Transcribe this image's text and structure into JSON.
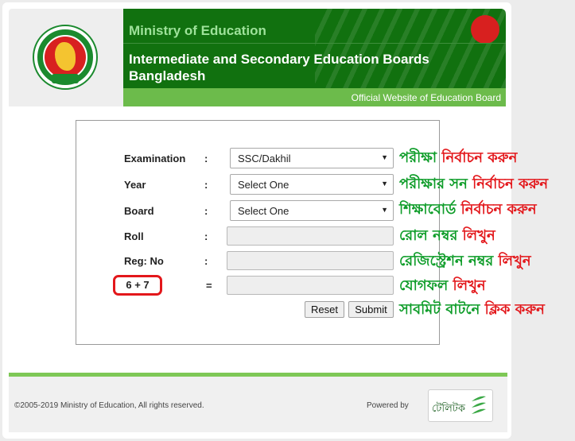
{
  "header": {
    "ministry_title": "Ministry of Education",
    "board_title": "Intermediate and Secondary Education Boards Bangladesh",
    "subtitle": "Official Website of Education Board",
    "seal_icon": "government-seal-icon"
  },
  "form": {
    "examination": {
      "label": "Examination",
      "colon": ":",
      "selected": "SSC/Dakhil"
    },
    "year": {
      "label": "Year",
      "colon": ":",
      "selected": "Select One"
    },
    "board": {
      "label": "Board",
      "colon": ":",
      "selected": "Select One"
    },
    "roll": {
      "label": "Roll",
      "colon": ":",
      "value": ""
    },
    "reg": {
      "label": "Reg: No",
      "colon": ":",
      "value": ""
    },
    "captcha": {
      "question": "6 + 7",
      "equals": "=",
      "value": ""
    },
    "reset_label": "Reset",
    "submit_label": "Submit"
  },
  "hints": {
    "examination": {
      "green": "পরীক্ষা",
      "red": "নির্বাচন করুন"
    },
    "year": {
      "green": "পরীক্ষার সন",
      "red": "নির্বাচন করুন"
    },
    "board": {
      "green": "শিক্ষাবোর্ড",
      "red": "নির্বাচন করুন"
    },
    "roll": {
      "green": "রোল নম্বর",
      "red": "লিখুন"
    },
    "reg": {
      "green": "রেজিস্ট্রেশন নম্বর",
      "red": "লিখুন"
    },
    "captcha": {
      "green": "যোগফল",
      "red": "লিখুন"
    },
    "submit": {
      "green": "সাবমিট বাটনে",
      "red": "ক্লিক করুন"
    }
  },
  "footer": {
    "copyright": "©2005-2019 Ministry of Education, All rights reserved.",
    "powered_by": "Powered by",
    "vendor_logo_text": "টেলিটক"
  },
  "colors": {
    "header_green": "#11710f",
    "subbar_green": "#6cbb4b",
    "hint_green": "#0f9d2a",
    "hint_red": "#e3171b"
  }
}
